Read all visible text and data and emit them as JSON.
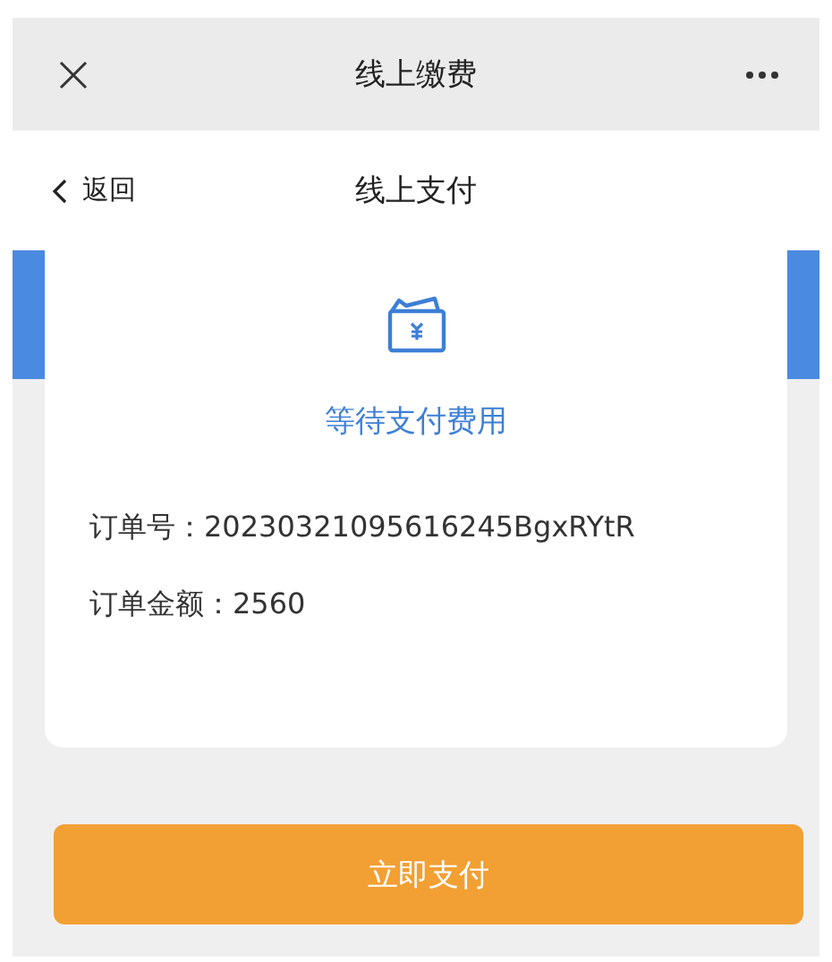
{
  "window": {
    "title": "线上缴费"
  },
  "nav": {
    "back": "返回",
    "title": "线上支付"
  },
  "status": "等待支付费用",
  "details": [
    "订单号：20230321095616245BgxRYtR",
    "订单金额：2560"
  ],
  "pay_button": "立即支付"
}
